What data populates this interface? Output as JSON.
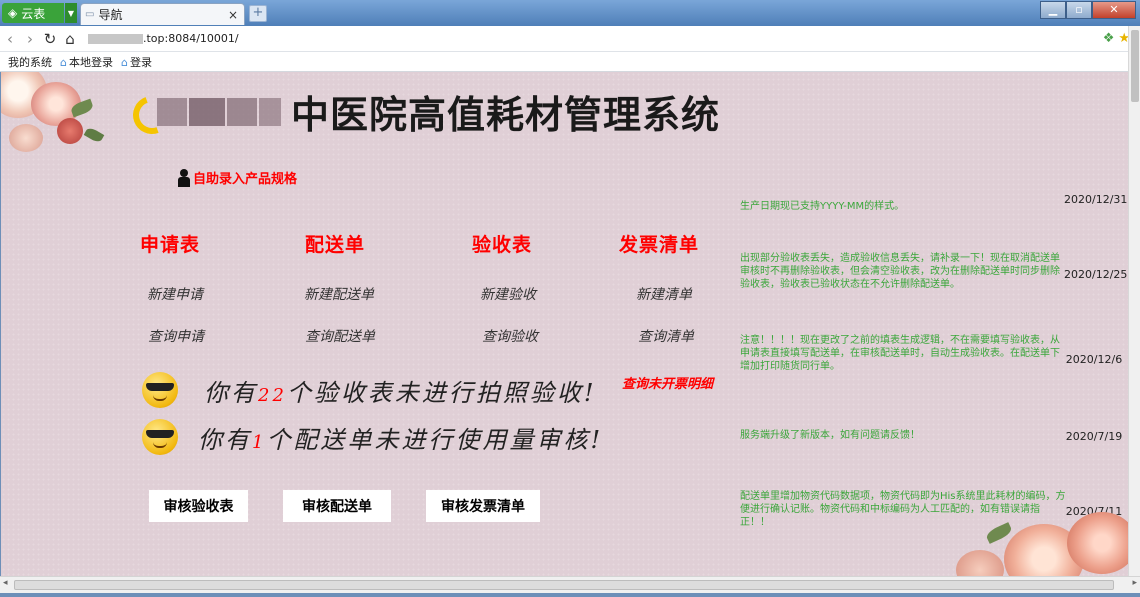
{
  "browser": {
    "app_tab_label": "云表",
    "tab_title": "导航",
    "tab_close": "×",
    "new_tab": "+",
    "url_visible": ".top:8084/10001/",
    "bookmarks": [
      "我的系统",
      "本地登录",
      "登录"
    ]
  },
  "header": {
    "title": "中医院高值耗材管理系统"
  },
  "self_entry_label": "自助录入产品规格",
  "columns": [
    {
      "heading": "申请表",
      "new_label": "新建申请",
      "query_label": "查询申请"
    },
    {
      "heading": "配送单",
      "new_label": "新建配送单",
      "query_label": "查询配送单"
    },
    {
      "heading": "验收表",
      "new_label": "新建验收",
      "query_label": "查询验收"
    },
    {
      "heading": "发票清单",
      "new_label": "新建清单",
      "query_label": "查询清单"
    }
  ],
  "notices": [
    {
      "prefix": "你有",
      "count": "22",
      "suffix": "个验收表未进行拍照验收!"
    },
    {
      "prefix": "你有",
      "count": "1",
      "suffix": "个配送单未进行使用量审核!"
    }
  ],
  "uninvoiced_link": "查询未开票明细",
  "audit_buttons": [
    "审核验收表",
    "审核配送单",
    "审核发票清单"
  ],
  "news": [
    {
      "text": "生产日期现已支持YYYY-MM的样式。",
      "date": "2020/12/31"
    },
    {
      "text": "出现部分验收表丢失，造成验收信息丢失，请补录一下！现在取消配送单审核时不再删除验收表，但会清空验收表，改为在删除配送单时同步删除验收表，验收表已验收状态在不允许删除配送单。",
      "date": "2020/12/25"
    },
    {
      "text": "注意！！！！现在更改了之前的填表生成逻辑，不在需要填写验收表，从申请表直接填写配送单，在审核配送单时，自动生成验收表。在配送单下增加打印随货同行单。",
      "date": "2020/12/6"
    },
    {
      "text": "服务端升级了新版本，如有问题请反馈！",
      "date": "2020/7/19"
    },
    {
      "text": "配送单里增加物资代码数据项，物资代码即为His系统里此耗材的编码，方便进行确认记账。物资代码和中标编码为人工匹配的，如有错误请指正！！",
      "date": "2020/7/11"
    }
  ],
  "colors": {
    "accent": "#ff0000",
    "news_green": "#3aa63a",
    "background": "#e0cfd6"
  }
}
